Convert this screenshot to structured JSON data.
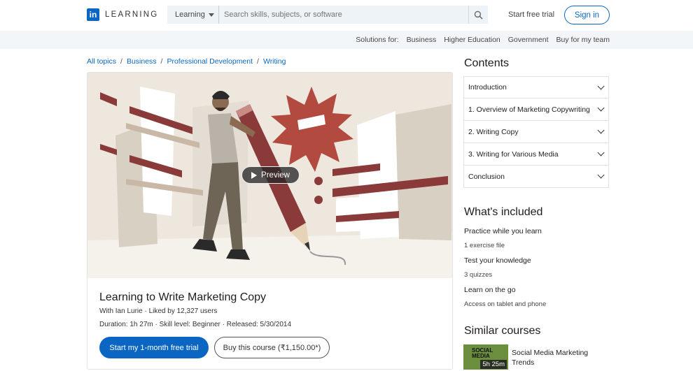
{
  "header": {
    "logo_mark": "in",
    "logo_text": "LEARNING",
    "search_category": "Learning",
    "search_placeholder": "Search skills, subjects, or software",
    "trial_link": "Start free trial",
    "signin": "Sign in"
  },
  "subbar": {
    "label": "Solutions for:",
    "items": [
      "Business",
      "Higher Education",
      "Government",
      "Buy for my team"
    ]
  },
  "breadcrumb": [
    "All topics",
    "Business",
    "Professional Development",
    "Writing"
  ],
  "course": {
    "preview_label": "Preview",
    "title": "Learning to Write Marketing Copy",
    "byline": "With Ian Lurie · Liked by 12,327 users",
    "meta": "Duration: 1h 27m · Skill level: Beginner · Released: 5/30/2014",
    "primary_cta": "Start my 1-month free trial",
    "secondary_cta": "Buy this course (₹1,150.00*)"
  },
  "contents": {
    "heading": "Contents",
    "items": [
      "Introduction",
      "1. Overview of Marketing Copywriting",
      "2. Writing Copy",
      "3. Writing for Various Media",
      "Conclusion"
    ]
  },
  "included": {
    "heading": "What's included",
    "items": [
      {
        "name": "Practice while you learn",
        "value": "1 exercise file"
      },
      {
        "name": "Test your knowledge",
        "value": "3 quizzes"
      },
      {
        "name": "Learn on the go",
        "value": "Access on tablet and phone"
      }
    ]
  },
  "similar": {
    "heading": "Similar courses",
    "items": [
      {
        "thumb_text_1": "SOCIAL",
        "thumb_text_2": "MEDIA",
        "duration": "5h 25m",
        "title": "Social Media Marketing Trends"
      }
    ]
  },
  "colors": {
    "brand": "#0a66c2",
    "hero_bg": "#ede7de",
    "accent_red": "#8b3a3a"
  }
}
